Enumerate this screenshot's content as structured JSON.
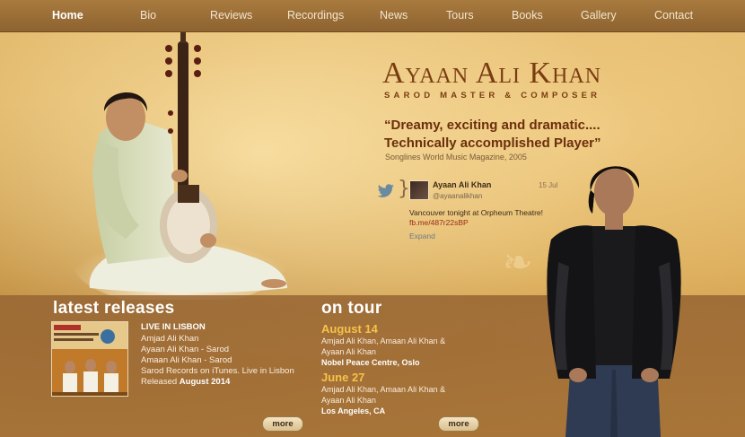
{
  "nav": {
    "items": [
      {
        "label": "Home",
        "active": true
      },
      {
        "label": "Bio"
      },
      {
        "label": "Reviews"
      },
      {
        "label": "Recordings"
      },
      {
        "label": "News"
      },
      {
        "label": "Tours"
      },
      {
        "label": "Books"
      },
      {
        "label": "Gallery"
      },
      {
        "label": "Contact"
      }
    ]
  },
  "hero": {
    "name": "Ayaan Ali Khan",
    "subtitle": "SAROD MASTER & COMPOSER",
    "quote_line1": "“Dreamy, exciting and dramatic....",
    "quote_line2": "Technically accomplished Player”",
    "quote_source": "Songlines World Music Magazine, 2005"
  },
  "tweet": {
    "name": "Ayaan Ali Khan",
    "handle": "@ayaanalikhan",
    "date": "15 Jul",
    "text": "Vancouver tonight at Orpheum Theatre!",
    "link": "fb.me/487r22sBP",
    "expand": "Expand"
  },
  "releases": {
    "title": "latest releases",
    "album_title": "LIVE IN LISBON",
    "lines": [
      "Amjad Ali Khan",
      "Ayaan Ali Khan - Sarod",
      "Amaan Ali Khan - Sarod",
      "Sarod Records on iTunes. Live in Lisbon"
    ],
    "released_prefix": "Released",
    "released_date": "August 2014",
    "more_label": "more"
  },
  "tour": {
    "title": "on tour",
    "events": [
      {
        "date": "August 14",
        "line1": "Amjad Ali Khan, Amaan Ali Khan &",
        "line2": "Ayaan Ali Khan",
        "venue": "Nobel Peace Centre, Oslo"
      },
      {
        "date": "June 27",
        "line1": "Amjad Ali Khan, Amaan Ali Khan &",
        "line2": "Ayaan Ali Khan",
        "venue": "Los Angeles, CA"
      }
    ],
    "more_label": "more"
  },
  "icons": {
    "twitter": "twitter-bird-icon",
    "brace": "}"
  },
  "colors": {
    "nav_bg": "#8e6330",
    "brand": "#7a3d12",
    "tour_date": "#f5c24a",
    "link": "#9c2a14"
  }
}
